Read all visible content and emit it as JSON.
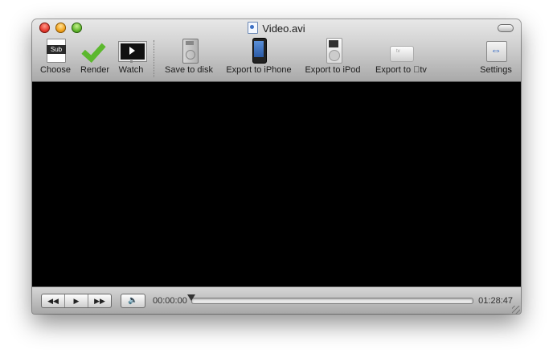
{
  "window": {
    "title": "Video.avi"
  },
  "toolbar": {
    "items": [
      {
        "label": "Choose",
        "icon": "subtitle-file-icon"
      },
      {
        "label": "Render",
        "icon": "checkmark-icon"
      },
      {
        "label": "Watch",
        "icon": "monitor-play-icon"
      },
      {
        "label": "Save to disk",
        "icon": "hard-disk-icon"
      },
      {
        "label": "Export to iPhone",
        "icon": "iphone-icon"
      },
      {
        "label": "Export to iPod",
        "icon": "ipod-icon"
      },
      {
        "label": "Export to tv",
        "icon": "apple-tv-icon"
      },
      {
        "label": "Settings",
        "icon": "settings-arrows-icon"
      }
    ]
  },
  "subtitle_icon_text": "Sub",
  "player": {
    "current_time": "00:00:00",
    "total_time": "01:28:47",
    "progress": 0.0,
    "rewind_glyph": "◀◀",
    "play_glyph": "▶",
    "forward_glyph": "▶▶",
    "volume_glyph": "🔈"
  }
}
